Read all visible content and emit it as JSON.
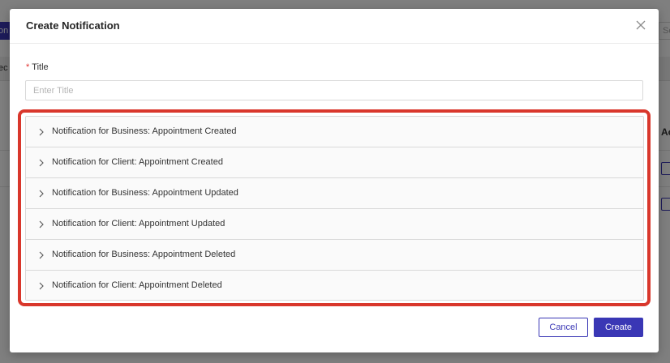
{
  "background": {
    "left_button_label": "on",
    "search_placeholder": "Se",
    "tab_text": "ec",
    "column_header": "Ac"
  },
  "modal": {
    "title": "Create Notification",
    "close_icon": "close-icon",
    "title_field": {
      "required_mark": "*",
      "label": "Title",
      "placeholder": "Enter Title",
      "value": ""
    },
    "sections": [
      {
        "label": "Notification for Business: Appointment Created",
        "expanded": false
      },
      {
        "label": "Notification for Client: Appointment Created",
        "expanded": false
      },
      {
        "label": "Notification for Business: Appointment Updated",
        "expanded": false
      },
      {
        "label": "Notification for Client: Appointment Updated",
        "expanded": false
      },
      {
        "label": "Notification for Business: Appointment Deleted",
        "expanded": false
      },
      {
        "label": "Notification for Client: Appointment Deleted",
        "expanded": false
      }
    ],
    "footer": {
      "cancel_label": "Cancel",
      "create_label": "Create"
    }
  },
  "colors": {
    "primary": "#3a37b5",
    "highlight": "#d9372c",
    "required": "#e0312e"
  }
}
